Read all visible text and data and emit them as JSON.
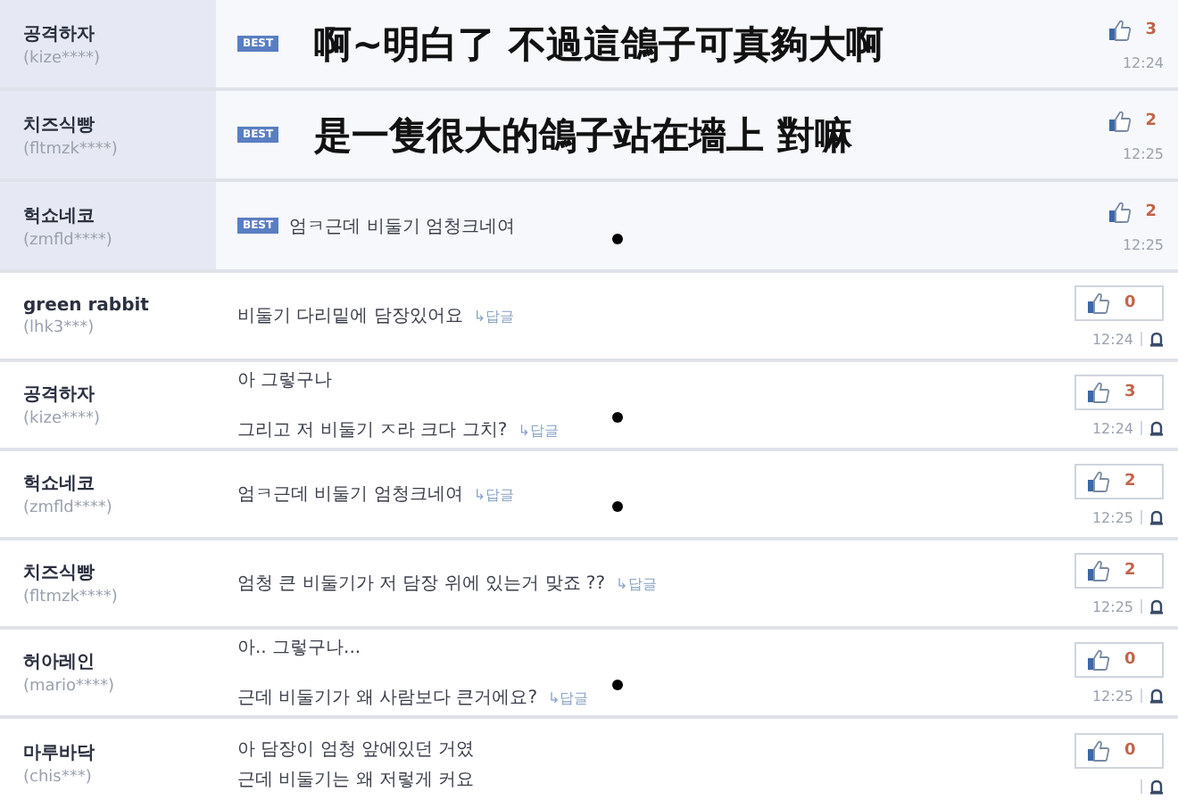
{
  "comments": [
    {
      "kind": "best",
      "nickname": "공격하자",
      "user_id": "(kize****)",
      "badge": "BEST",
      "lines": [
        "啊~明白了  不過這鴿子可真夠大啊"
      ],
      "likes": "3",
      "time": "12:24",
      "dot": false
    },
    {
      "kind": "best",
      "nickname": "치즈식빵",
      "user_id": "(fltmzk****)",
      "badge": "BEST",
      "lines": [
        "是一隻很大的鴿子站在墻上  對嘛"
      ],
      "likes": "2",
      "time": "12:25",
      "dot": false
    },
    {
      "kind": "best",
      "nickname": "헉쇼네코",
      "user_id": "(zmfld****)",
      "badge": "BEST",
      "lines": [
        "엄ㅋ근데 비둘기 엄청크네여"
      ],
      "likes": "2",
      "time": "12:25",
      "dot": true
    },
    {
      "kind": "normal",
      "nickname": "green rabbit",
      "user_id": "(lhk3***)",
      "lines": [
        "비둘기 다리밑에 담장있어요"
      ],
      "reply": "↳답글",
      "likes": "0",
      "time": "12:24",
      "dot": false
    },
    {
      "kind": "normal",
      "nickname": "공격하자",
      "user_id": "(kize****)",
      "lines": [
        "아 그렇구나",
        "그리고 저 비둘기 ㅈ라 크다 그치?"
      ],
      "reply": "↳답글",
      "likes": "3",
      "time": "12:24",
      "dot": true
    },
    {
      "kind": "normal",
      "nickname": "헉쇼네코",
      "user_id": "(zmfld****)",
      "lines": [
        "엄ㅋ근데 비둘기 엄청크네여"
      ],
      "reply": "↳답글",
      "likes": "2",
      "time": "12:25",
      "dot": true
    },
    {
      "kind": "normal",
      "nickname": "치즈식빵",
      "user_id": "(fltmzk****)",
      "lines": [
        "엄청 큰 비둘기가 저 담장 위에 있는거 맞죠 ??"
      ],
      "reply": "↳답글",
      "likes": "2",
      "time": "12:25",
      "dot": false
    },
    {
      "kind": "normal",
      "nickname": "허아레인",
      "user_id": "(mario****)",
      "lines": [
        "아.. 그렇구나...",
        "근데 비둘기가 왜 사람보다 큰거에요?"
      ],
      "reply": "↳답글",
      "likes": "0",
      "time": "12:25",
      "dot": true
    },
    {
      "kind": "normal",
      "nickname": "마루바닥",
      "user_id": "(chis***)",
      "lines": [
        "아 담장이 엄청 앞에있던 거였",
        "근데 비둘기는 왜 저렇게 커요"
      ],
      "likes": "0",
      "dot": false
    }
  ]
}
